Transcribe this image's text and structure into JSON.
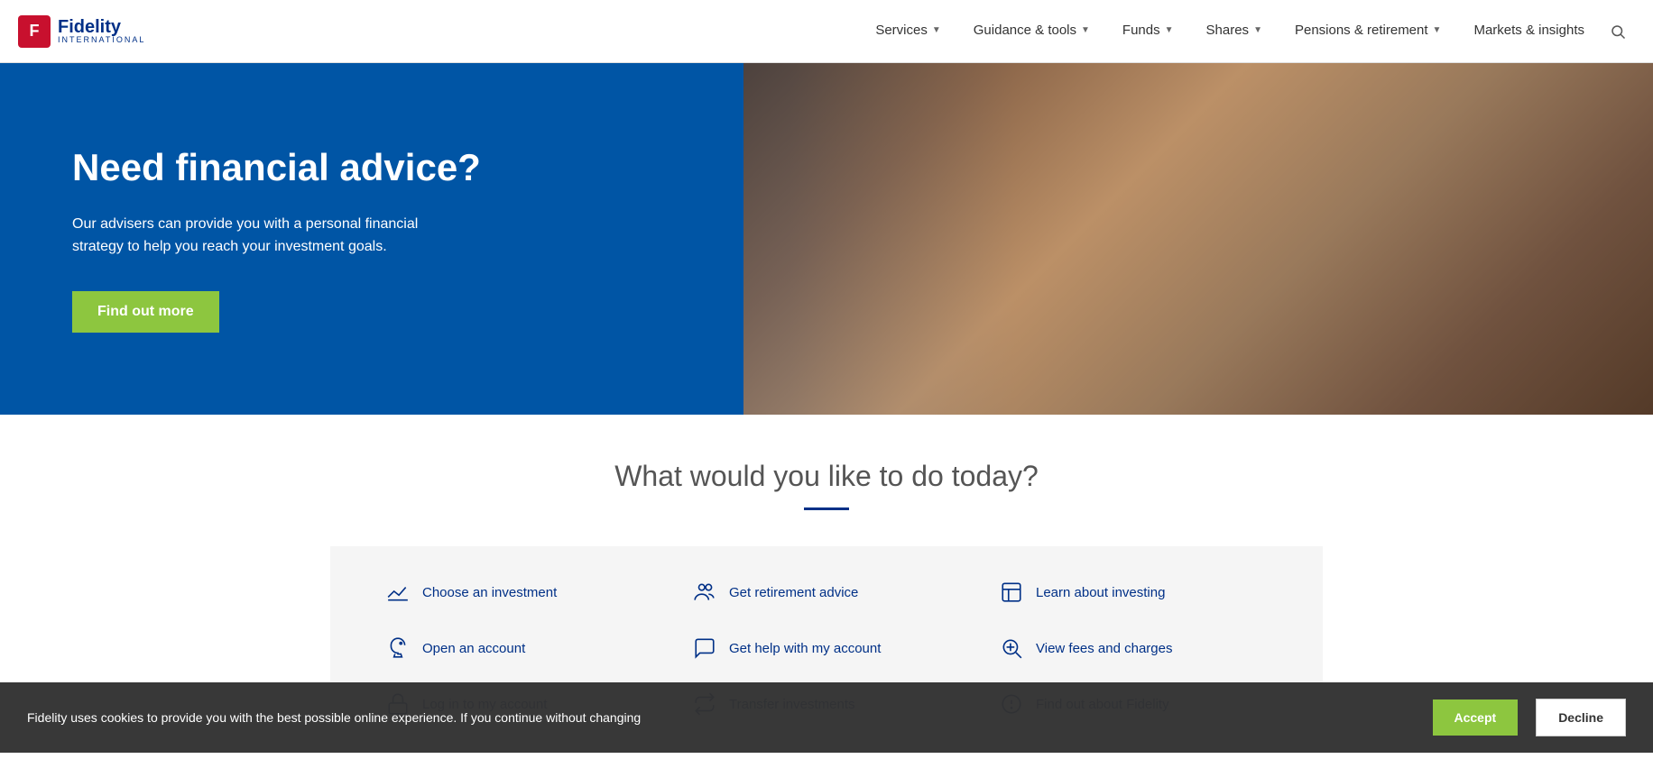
{
  "header": {
    "logo_letter": "F",
    "logo_name": "Fidelity",
    "logo_sub": "INTERNATIONAL",
    "nav": [
      {
        "id": "services",
        "label": "Services",
        "hasDropdown": true
      },
      {
        "id": "guidance-tools",
        "label": "Guidance & tools",
        "hasDropdown": true
      },
      {
        "id": "funds",
        "label": "Funds",
        "hasDropdown": true
      },
      {
        "id": "shares",
        "label": "Shares",
        "hasDropdown": true
      },
      {
        "id": "pensions",
        "label": "Pensions & retirement",
        "hasDropdown": true
      },
      {
        "id": "markets",
        "label": "Markets & insights",
        "hasDropdown": false
      }
    ]
  },
  "hero": {
    "title": "Need financial advice?",
    "description": "Our advisers can provide you with a personal financial strategy to help you reach your investment goals.",
    "cta_label": "Find out more"
  },
  "section": {
    "title": "What would you like to do today?"
  },
  "actions": [
    {
      "id": "choose-investment",
      "label": "Choose an investment",
      "icon": "chart"
    },
    {
      "id": "get-retirement-advice",
      "label": "Get retirement advice",
      "icon": "people"
    },
    {
      "id": "learn-investing",
      "label": "Learn about investing",
      "icon": "book"
    },
    {
      "id": "open-account",
      "label": "Open an account",
      "icon": "piggy"
    },
    {
      "id": "get-help-account",
      "label": "Get help with my account",
      "icon": "chat"
    },
    {
      "id": "view-fees",
      "label": "View fees and charges",
      "icon": "magnify"
    },
    {
      "id": "log-in",
      "label": "Log in to my account",
      "icon": "lock"
    },
    {
      "id": "transfer-investments",
      "label": "Transfer investments",
      "icon": "transfer"
    },
    {
      "id": "find-fidelity",
      "label": "Find out about Fidelity",
      "icon": "info"
    }
  ],
  "cookie": {
    "text": "Fidelity uses cookies to provide you with the best possible online experience. If you continue without changing",
    "accept_label": "Accept",
    "decline_label": "Decline"
  }
}
